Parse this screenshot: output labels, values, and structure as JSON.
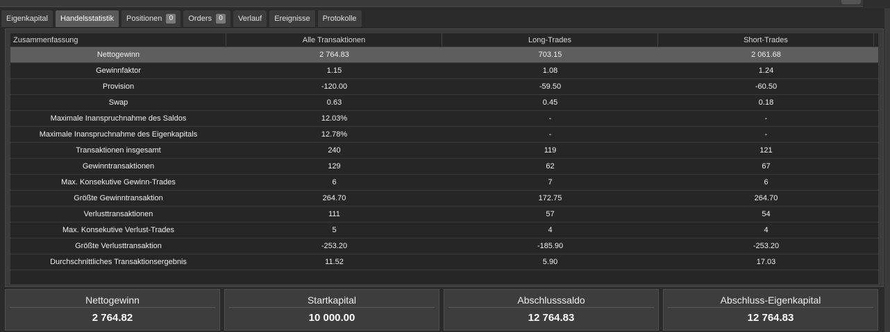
{
  "tabs": [
    {
      "label": "Eigenkapital",
      "badge": null,
      "active": false
    },
    {
      "label": "Handelsstatistik",
      "badge": null,
      "active": true
    },
    {
      "label": "Positionen",
      "badge": "0",
      "active": false
    },
    {
      "label": "Orders",
      "badge": "0",
      "active": false
    },
    {
      "label": "Verlauf",
      "badge": null,
      "active": false
    },
    {
      "label": "Ereignisse",
      "badge": null,
      "active": false
    },
    {
      "label": "Protokolle",
      "badge": null,
      "active": false
    }
  ],
  "table": {
    "headers": [
      "Zusammenfassung",
      "Alle Transaktionen",
      "Long-Trades",
      "Short-Trades"
    ],
    "rows": [
      [
        "Nettogewinn",
        "2 764.83",
        "703.15",
        "2 061.68"
      ],
      [
        "Gewinnfaktor",
        "1.15",
        "1.08",
        "1.24"
      ],
      [
        "Provision",
        "-120.00",
        "-59.50",
        "-60.50"
      ],
      [
        "Swap",
        "0.63",
        "0.45",
        "0.18"
      ],
      [
        "Maximale Inanspruchnahme des Saldos",
        "12.03%",
        "-",
        "-"
      ],
      [
        "Maximale Inanspruchnahme des Eigenkapitals",
        "12.78%",
        "-",
        "-"
      ],
      [
        "Transaktionen insgesamt",
        "240",
        "119",
        "121"
      ],
      [
        "Gewinntransaktionen",
        "129",
        "62",
        "67"
      ],
      [
        "Max. Konsekutive Gewinn-Trades",
        "6",
        "7",
        "6"
      ],
      [
        "Größte Gewinntransaktion",
        "264.70",
        "172.75",
        "264.70"
      ],
      [
        "Verlusttransaktionen",
        "111",
        "57",
        "54"
      ],
      [
        "Max. Konsekutive Verlust-Trades",
        "5",
        "4",
        "4"
      ],
      [
        "Größte Verlusttransaktion",
        "-253.20",
        "-185.90",
        "-253.20"
      ],
      [
        "Durchschnittliches Transaktionsergebnis",
        "11.52",
        "5.90",
        "17.03"
      ]
    ],
    "selected_row": 0
  },
  "summary": [
    {
      "title": "Nettogewinn",
      "value": "2 764.82"
    },
    {
      "title": "Startkapital",
      "value": "10 000.00"
    },
    {
      "title": "Abschlusssaldo",
      "value": "12 764.83"
    },
    {
      "title": "Abschluss-Eigenkapital",
      "value": "12 764.83"
    }
  ]
}
